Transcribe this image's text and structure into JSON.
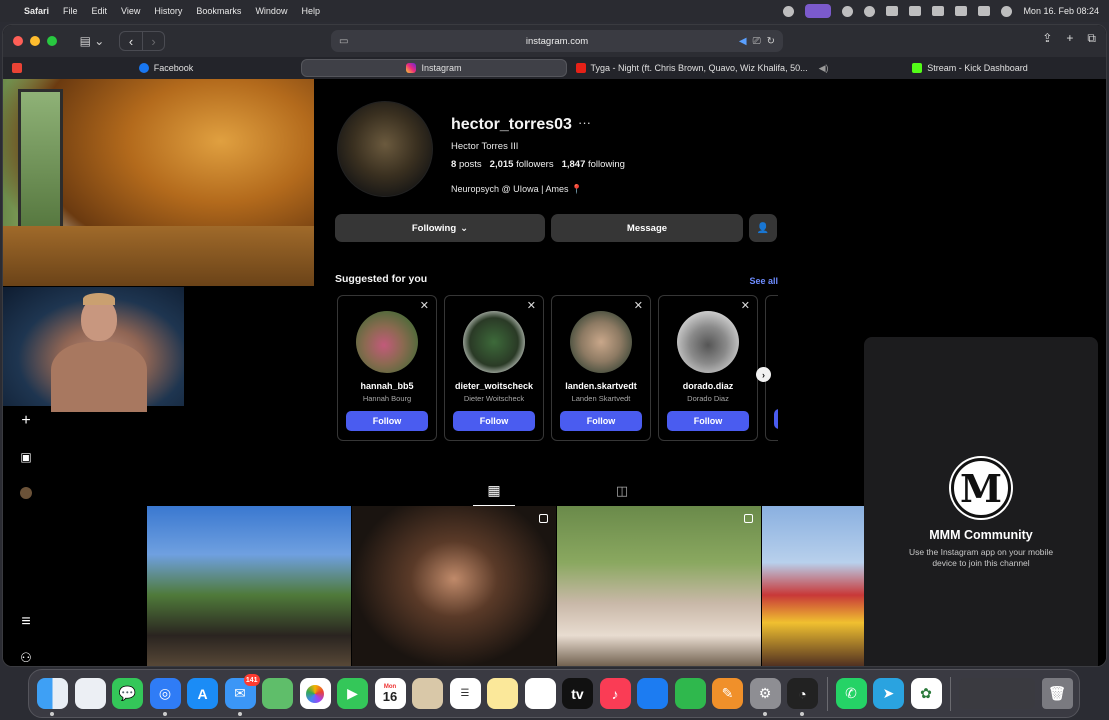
{
  "menubar": {
    "app": "Safari",
    "items": [
      "File",
      "Edit",
      "View",
      "History",
      "Bookmarks",
      "Window",
      "Help"
    ],
    "clock": "Mon 16. Feb  08:24"
  },
  "safari": {
    "url": "instagram.com",
    "tabs": [
      {
        "label": "",
        "favicon": "gmail-icon"
      },
      {
        "label": "Facebook",
        "favicon": "facebook-icon"
      },
      {
        "label": "Instagram",
        "favicon": "instagram-icon",
        "active": true
      },
      {
        "label": "Tyga - Night (ft. Chris Brown, Quavo, Wiz Khalifa, 50...",
        "favicon": "youtube-icon",
        "audio": true
      },
      {
        "label": "Stream - Kick Dashboard",
        "favicon": "kick-icon"
      }
    ]
  },
  "profile": {
    "username": "hector_torres03",
    "more": "···",
    "full_name": "Hector Torres III",
    "posts_count": "8",
    "posts_label": "posts",
    "followers_count": "2,015",
    "followers_label": "followers",
    "following_count": "1,847",
    "following_label": "following",
    "bio": "Neuropsych @ UIowa | Ames 📍",
    "following_button": "Following",
    "message_button": "Message"
  },
  "suggested": {
    "title": "Suggested for you",
    "see_all": "See all",
    "follow_label": "Follow",
    "cards": [
      {
        "username": "hannah_bb5",
        "name": "Hannah Bourg"
      },
      {
        "username": "dieter_woitscheck",
        "name": "Dieter Woitscheck"
      },
      {
        "username": "landen.skartvedt",
        "name": "Landen Skartvedt"
      },
      {
        "username": "dorado.diaz",
        "name": "Dorado Diaz"
      }
    ]
  },
  "channel": {
    "logo_letter": "M",
    "title": "MMM Community",
    "description": "Use the Instagram app on your mobile device to join this channel"
  },
  "dock": {
    "mail_badge": "141",
    "calendar_month": "Mon",
    "calendar_day": "16",
    "apps": [
      "finder",
      "launchpad",
      "messages",
      "safari",
      "app-store",
      "mail",
      "maps",
      "photos",
      "facetime",
      "calendar",
      "contacts",
      "reminders",
      "notes",
      "freeform",
      "tv",
      "music",
      "keynote",
      "numbers",
      "pages",
      "system-settings",
      "activity-monitor",
      "whatsapp",
      "telegram",
      "chatgpt"
    ]
  }
}
